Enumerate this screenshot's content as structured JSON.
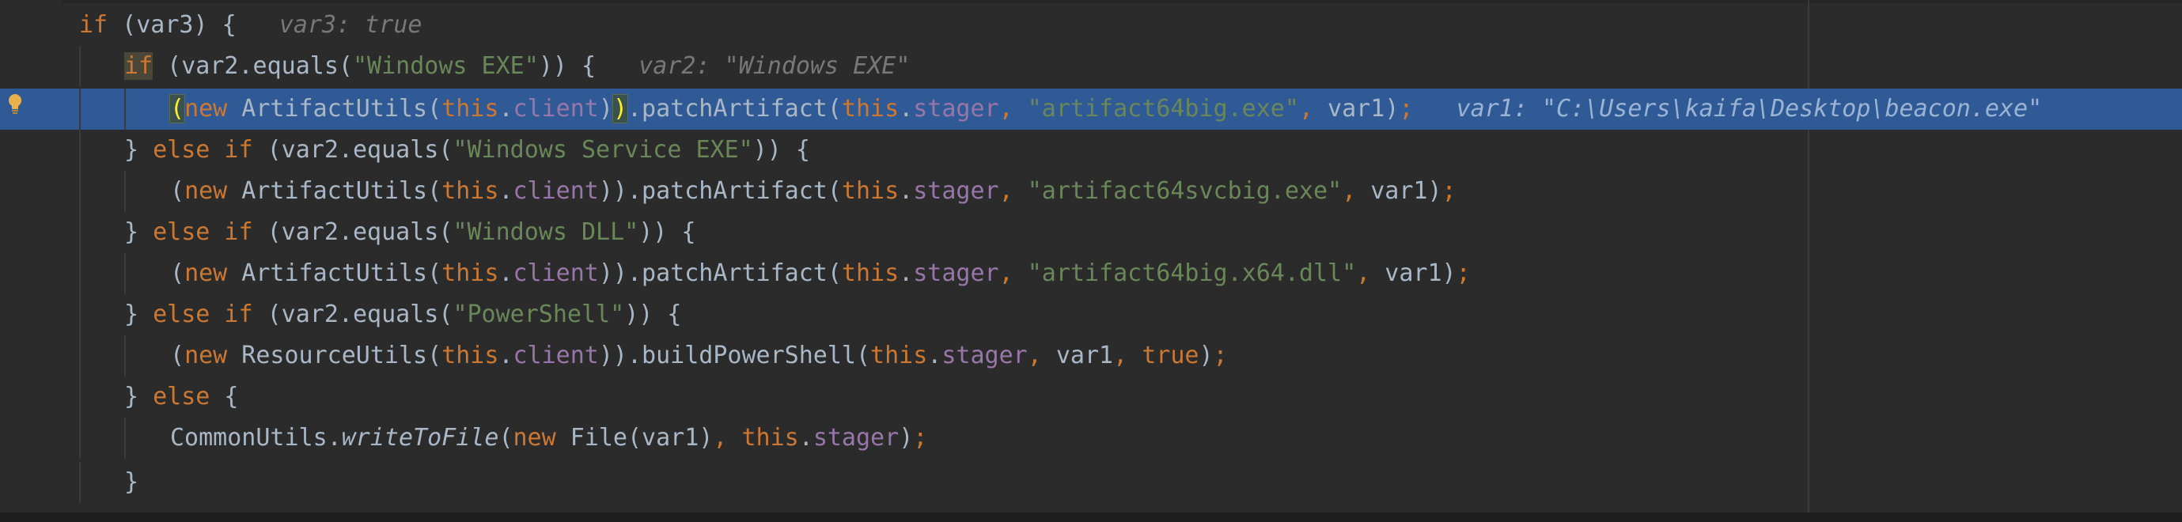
{
  "lines": [
    {
      "tokens": [
        {
          "t": "if",
          "c": "kw"
        },
        {
          "t": " (var3) {",
          "c": "p"
        },
        {
          "t": "   var3: true",
          "c": "hint"
        }
      ]
    },
    {
      "tokens": [
        {
          "t": "if",
          "c": "kw kw-hl"
        },
        {
          "t": " (var2.equals(",
          "c": "p"
        },
        {
          "t": "\"Windows EXE\"",
          "c": "str"
        },
        {
          "t": ")) {",
          "c": "p"
        },
        {
          "t": "   var2: \"Windows EXE\"",
          "c": "hint"
        }
      ]
    },
    {
      "current": true,
      "tokens": [
        {
          "t": "(",
          "c": "brace-hl"
        },
        {
          "t": "new",
          "c": "kw"
        },
        {
          "t": " ArtifactUtils(",
          "c": "p"
        },
        {
          "t": "this",
          "c": "kw"
        },
        {
          "t": ".",
          "c": "p"
        },
        {
          "t": "client",
          "c": "fld"
        },
        {
          "t": ")",
          "c": "p"
        },
        {
          "t": ")",
          "c": "brace-hl"
        },
        {
          "t": ".patchArtifact(",
          "c": "p"
        },
        {
          "t": "this",
          "c": "kw"
        },
        {
          "t": ".",
          "c": "p"
        },
        {
          "t": "stager",
          "c": "fld"
        },
        {
          "t": ", ",
          "c": "kw"
        },
        {
          "t": "\"artifact64big.exe\"",
          "c": "str"
        },
        {
          "t": ", ",
          "c": "kw"
        },
        {
          "t": "var1)",
          "c": "p"
        },
        {
          "t": ";",
          "c": "kw"
        },
        {
          "t": "   var1: \"C:\\Users\\kaifa\\Desktop\\beacon.exe\"",
          "c": "hint"
        }
      ]
    },
    {
      "tokens": [
        {
          "t": "} ",
          "c": "p"
        },
        {
          "t": "else if",
          "c": "kw"
        },
        {
          "t": " (var2.equals(",
          "c": "p"
        },
        {
          "t": "\"Windows Service EXE\"",
          "c": "str"
        },
        {
          "t": ")) {",
          "c": "p"
        }
      ]
    },
    {
      "tokens": [
        {
          "t": "(",
          "c": "p"
        },
        {
          "t": "new",
          "c": "kw"
        },
        {
          "t": " ArtifactUtils(",
          "c": "p"
        },
        {
          "t": "this",
          "c": "kw"
        },
        {
          "t": ".",
          "c": "p"
        },
        {
          "t": "client",
          "c": "fld"
        },
        {
          "t": ")).patchArtifact(",
          "c": "p"
        },
        {
          "t": "this",
          "c": "kw"
        },
        {
          "t": ".",
          "c": "p"
        },
        {
          "t": "stager",
          "c": "fld"
        },
        {
          "t": ", ",
          "c": "kw"
        },
        {
          "t": "\"artifact64svcbig.exe\"",
          "c": "str"
        },
        {
          "t": ", ",
          "c": "kw"
        },
        {
          "t": "var1)",
          "c": "p"
        },
        {
          "t": ";",
          "c": "kw"
        }
      ]
    },
    {
      "tokens": [
        {
          "t": "} ",
          "c": "p"
        },
        {
          "t": "else if",
          "c": "kw"
        },
        {
          "t": " (var2.equals(",
          "c": "p"
        },
        {
          "t": "\"Windows DLL\"",
          "c": "str"
        },
        {
          "t": ")) {",
          "c": "p"
        }
      ]
    },
    {
      "tokens": [
        {
          "t": "(",
          "c": "p"
        },
        {
          "t": "new",
          "c": "kw"
        },
        {
          "t": " ArtifactUtils(",
          "c": "p"
        },
        {
          "t": "this",
          "c": "kw"
        },
        {
          "t": ".",
          "c": "p"
        },
        {
          "t": "client",
          "c": "fld"
        },
        {
          "t": ")).patchArtifact(",
          "c": "p"
        },
        {
          "t": "this",
          "c": "kw"
        },
        {
          "t": ".",
          "c": "p"
        },
        {
          "t": "stager",
          "c": "fld"
        },
        {
          "t": ", ",
          "c": "kw"
        },
        {
          "t": "\"artifact64big.x64.dll\"",
          "c": "str"
        },
        {
          "t": ", ",
          "c": "kw"
        },
        {
          "t": "var1)",
          "c": "p"
        },
        {
          "t": ";",
          "c": "kw"
        }
      ]
    },
    {
      "tokens": [
        {
          "t": "} ",
          "c": "p"
        },
        {
          "t": "else if",
          "c": "kw"
        },
        {
          "t": " (var2.equals(",
          "c": "p"
        },
        {
          "t": "\"PowerShell\"",
          "c": "str"
        },
        {
          "t": ")) {",
          "c": "p"
        }
      ]
    },
    {
      "tokens": [
        {
          "t": "(",
          "c": "p"
        },
        {
          "t": "new",
          "c": "kw"
        },
        {
          "t": " ResourceUtils(",
          "c": "p"
        },
        {
          "t": "this",
          "c": "kw"
        },
        {
          "t": ".",
          "c": "p"
        },
        {
          "t": "client",
          "c": "fld"
        },
        {
          "t": ")).buildPowerShell(",
          "c": "p"
        },
        {
          "t": "this",
          "c": "kw"
        },
        {
          "t": ".",
          "c": "p"
        },
        {
          "t": "stager",
          "c": "fld"
        },
        {
          "t": ", ",
          "c": "kw"
        },
        {
          "t": "var1",
          "c": "p"
        },
        {
          "t": ", ",
          "c": "kw"
        },
        {
          "t": "true",
          "c": "kw"
        },
        {
          "t": ")",
          "c": "p"
        },
        {
          "t": ";",
          "c": "kw"
        }
      ]
    },
    {
      "tokens": [
        {
          "t": "} ",
          "c": "p"
        },
        {
          "t": "else",
          "c": "kw"
        },
        {
          "t": " {",
          "c": "p"
        }
      ]
    },
    {
      "tokens": [
        {
          "t": "CommonUtils.",
          "c": "p"
        },
        {
          "t": "writeToFile",
          "c": "it"
        },
        {
          "t": "(",
          "c": "p"
        },
        {
          "t": "new",
          "c": "kw"
        },
        {
          "t": " File(var1)",
          "c": "p"
        },
        {
          "t": ", ",
          "c": "kw"
        },
        {
          "t": "this",
          "c": "kw"
        },
        {
          "t": ".",
          "c": "p"
        },
        {
          "t": "stager",
          "c": "fld"
        },
        {
          "t": ")",
          "c": "p"
        },
        {
          "t": ";",
          "c": "kw"
        }
      ]
    },
    {
      "tokens": [
        {
          "t": "}",
          "c": "p"
        }
      ]
    }
  ],
  "colors": {
    "background": "#2b2b2b",
    "current_line": "#2f5a96",
    "keyword": "#cc7832",
    "string": "#6a8759",
    "field": "#9876aa",
    "plain": "#a9b7c6",
    "hint": "#787878"
  },
  "icons": {
    "gutter": "lightbulb-icon"
  }
}
